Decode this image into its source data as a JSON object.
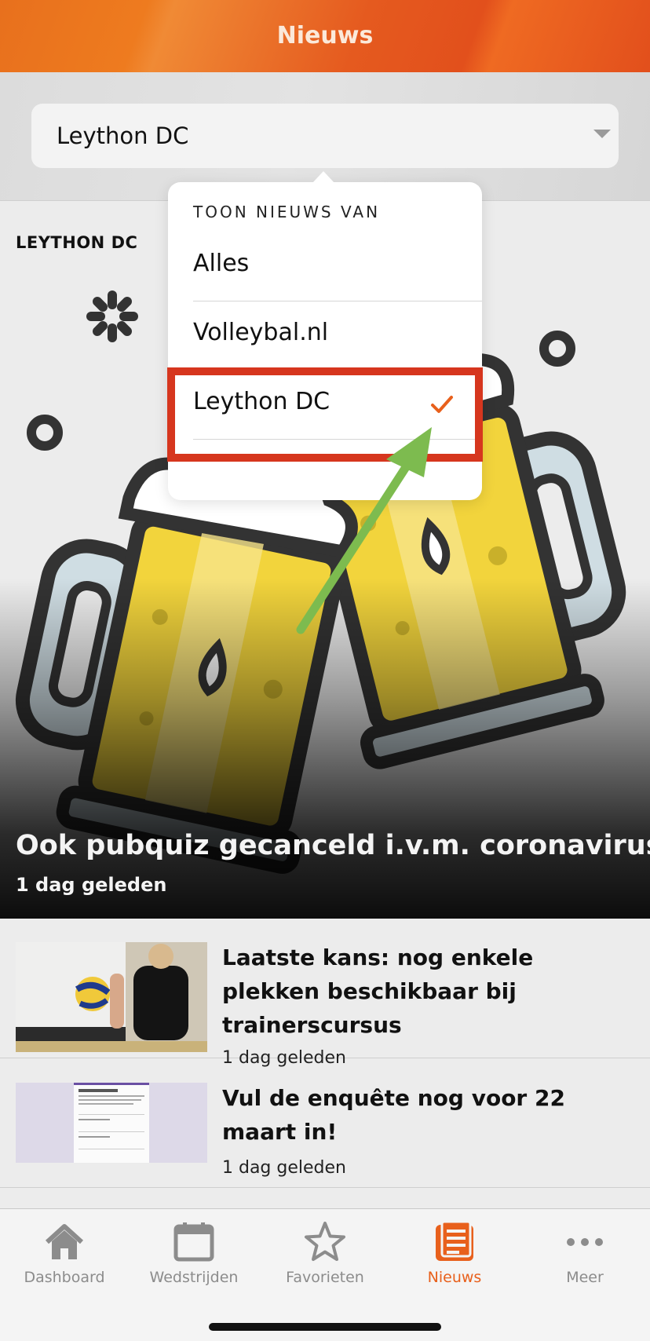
{
  "header": {
    "title": "Nieuws"
  },
  "filter": {
    "selected": "Leython DC"
  },
  "popover": {
    "heading": "TOON NIEUWS VAN",
    "options": [
      {
        "label": "Alles",
        "selected": false
      },
      {
        "label": "Volleybal.nl",
        "selected": false
      },
      {
        "label": "Leython DC",
        "selected": true
      }
    ]
  },
  "feed": {
    "club_label": "LEYTHON DC",
    "featured": {
      "title": "Ook pubquiz gecanceld i.v.m. coronavirus",
      "time": "1 dag geleden"
    },
    "items": [
      {
        "title": "Laatste kans: nog enkele plekken beschikbaar bij trainerscursus",
        "time": "1 dag geleden",
        "thumb_icon": "volleyball-players-photo"
      },
      {
        "title": "Vul de enquête nog voor 22 maart in!",
        "time": "1 dag geleden",
        "thumb_icon": "survey-form-screenshot"
      }
    ]
  },
  "tabbar": {
    "tabs": [
      {
        "label": "Dashboard",
        "icon": "home-icon",
        "active": false
      },
      {
        "label": "Wedstrijden",
        "icon": "calendar-icon",
        "active": false
      },
      {
        "label": "Favorieten",
        "icon": "star-icon",
        "active": false
      },
      {
        "label": "Nieuws",
        "icon": "news-icon",
        "active": true
      },
      {
        "label": "Meer",
        "icon": "more-icon",
        "active": false
      }
    ]
  },
  "colors": {
    "accent": "#e8601c",
    "highlight": "#d6361e",
    "annotation_arrow": "#7dbb4f"
  }
}
